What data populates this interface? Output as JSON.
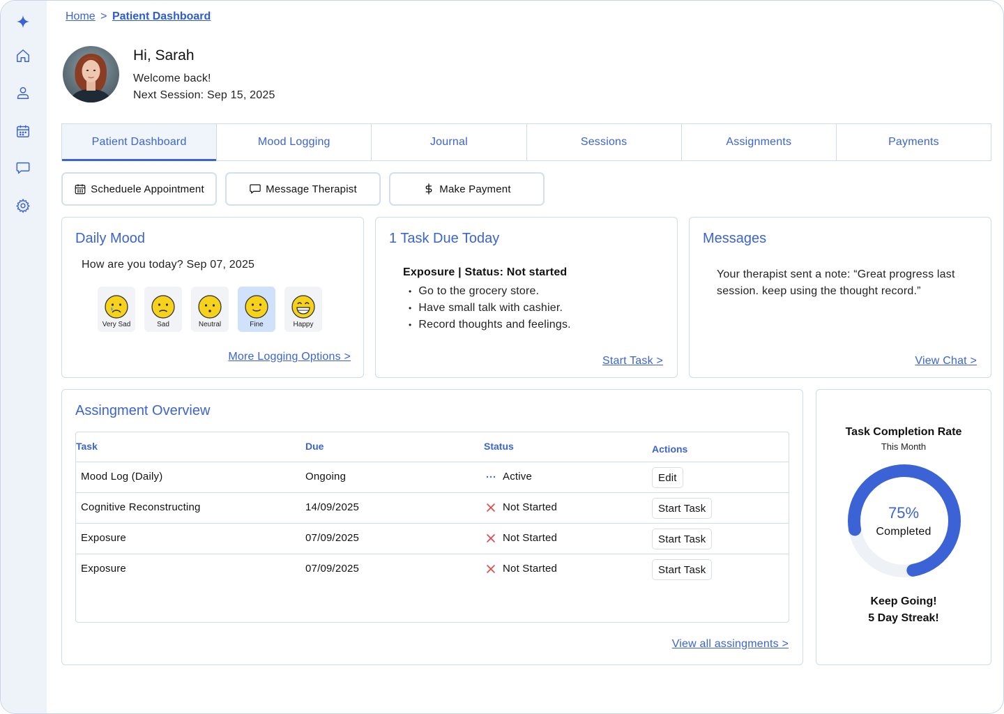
{
  "breadcrumb": {
    "home": "Home",
    "separator": ">",
    "current": "Patient Dashboard"
  },
  "sidebar": {
    "items": [
      {
        "name": "logo",
        "icon": "sparkle-icon"
      },
      {
        "name": "home",
        "icon": "home-icon"
      },
      {
        "name": "profile",
        "icon": "user-icon"
      },
      {
        "name": "calendar",
        "icon": "calendar-icon"
      },
      {
        "name": "messages",
        "icon": "chat-icon"
      },
      {
        "name": "settings",
        "icon": "gear-icon"
      }
    ]
  },
  "greeting": {
    "name": "Hi, Sarah",
    "welcome": "Welcome back!",
    "next_session": "Next Session: Sep 15, 2025"
  },
  "tabs": [
    {
      "label": "Patient Dashboard",
      "active": true
    },
    {
      "label": "Mood Logging",
      "active": false
    },
    {
      "label": "Journal",
      "active": false
    },
    {
      "label": "Sessions",
      "active": false
    },
    {
      "label": "Assignments",
      "active": false
    },
    {
      "label": "Payments",
      "active": false
    }
  ],
  "quick_actions": {
    "schedule": "Scheduele Appointment",
    "message": "Message Therapist",
    "payment": "Make Payment"
  },
  "daily_mood": {
    "title": "Daily Mood",
    "question": "How are you today? Sep 07, 2025",
    "options": [
      {
        "label": "Very Sad",
        "selected": false
      },
      {
        "label": "Sad",
        "selected": false
      },
      {
        "label": "Neutral",
        "selected": false
      },
      {
        "label": "Fine",
        "selected": true
      },
      {
        "label": "Happy",
        "selected": false
      }
    ],
    "link": "More Logging Options >"
  },
  "task_due": {
    "title": "1 Task Due Today",
    "task_name": "Exposure | ",
    "status_text": "Status: Not started",
    "steps": [
      "Go to the grocery store.",
      "Have small talk with cashier.",
      "Record thoughts and feelings."
    ],
    "link": "Start Task >"
  },
  "messages": {
    "title": "Messages",
    "text": "Your therapist sent a note: “Great progress last session. keep using the thought record.”",
    "link": "View Chat >"
  },
  "assignments": {
    "title": "Assingment Overview",
    "columns": {
      "task": "Task",
      "due": "Due",
      "status": "Status",
      "actions": "Actions"
    },
    "rows": [
      {
        "task": "Mood Log (Daily)",
        "due": "Ongoing",
        "status": "Active",
        "status_icon": "ellipsis-icon",
        "action": "Edit"
      },
      {
        "task": "Cognitive Reconstructing",
        "due": "14/09/2025",
        "status": "Not Started",
        "status_icon": "x-icon",
        "action": "Start Task"
      },
      {
        "task": "Exposure",
        "due": "07/09/2025",
        "status": "Not Started",
        "status_icon": "x-icon",
        "action": "Start Task"
      },
      {
        "task": "Exposure",
        "due": "07/09/2025",
        "status": "Not Started",
        "status_icon": "x-icon",
        "action": "Start Task"
      }
    ],
    "link": "View all assingments >"
  },
  "completion": {
    "title": "Task Completion Rate",
    "subtitle": "This Month",
    "percent_label": "75%",
    "percent": 75,
    "completed_label": "Completed",
    "streak_line1": "Keep Going!",
    "streak_line2": "5 Day Streak!"
  },
  "colors": {
    "accent": "#3b63d6",
    "border": "#cfdaea",
    "sidebar_bg": "#eef2f9",
    "selected_mood": "#cfe1fb",
    "error_red": "#e04848"
  }
}
